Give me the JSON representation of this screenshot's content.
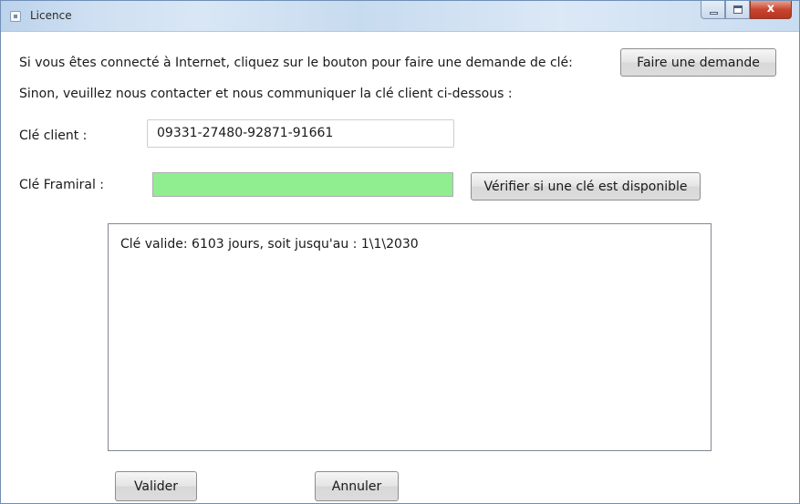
{
  "window": {
    "title": "Licence",
    "minimize_label": "",
    "maximize_label": "",
    "close_label": "x"
  },
  "intro": {
    "line1": "Si vous êtes connecté à Internet, cliquez sur le bouton pour faire une demande de clé:",
    "request_button": "Faire une demande",
    "line2": "Sinon, veuillez nous contacter et nous communiquer la clé client ci-dessous :"
  },
  "client_key": {
    "label": "Clé client :",
    "value": "09331-27480-92871-91661"
  },
  "framiral_key": {
    "label": "Clé Framiral :",
    "value": "",
    "status_color": "#90ee90",
    "check_button": "Vérifier si une clé est disponible"
  },
  "result": {
    "text": "Clé valide:   6103 jours, soit jusqu'au : 1\\1\\2030"
  },
  "footer": {
    "validate_button": "Valider",
    "cancel_button": "Annuler"
  }
}
